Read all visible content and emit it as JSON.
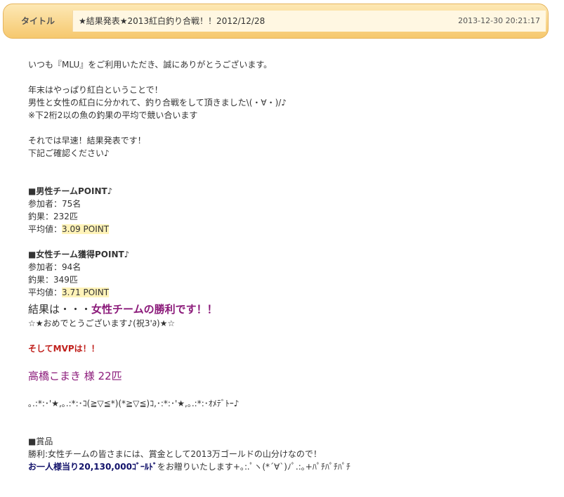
{
  "header": {
    "label": "タイトル",
    "subject": "★結果発表★2013紅白釣り合戦！！2012/12/28",
    "datetime": "2013-12-30 20:21:17"
  },
  "intro": {
    "l1": "いつも『MLU』をご利用いただき、誠にありがとうございます。",
    "l2": "年末はやっぱり紅白ということで！",
    "l3": "男性と女性の紅白に分かれて、釣り合戦をして頂きました\\(・∀・)/♪",
    "l4": "※下2桁2以の魚の釣果の平均で競い合います",
    "l5": "それでは早速！結果発表です！",
    "l6": "下記ご確認ください♪"
  },
  "male": {
    "title": "■男性チームPOINT♪",
    "participants": "参加者：75名",
    "catch": "釣果：232匹",
    "avg_label": "平均値：",
    "avg_value": "3.09 POINT"
  },
  "female": {
    "title": "■女性チーム獲得POINT♪",
    "participants": "参加者：94名",
    "catch": "釣果：349匹",
    "avg_label": "平均値：",
    "avg_value": "3.71 POINT"
  },
  "result": {
    "prefix": "結果は・・・",
    "win": "女性チームの勝利です！！",
    "congrats": "☆★おめでとうございます♪(祝3'∂)★☆"
  },
  "mvp": {
    "heading": "そしてMVPは！！",
    "name": "高橋こまき 様 22匹",
    "deco": "｡.:*:･'★,｡.:*:･ｺ(≧▽≦*)(*≧▽≦)ｺ,･:*:･'★,｡.:*:･ｵﾒﾃﾞﾄｰ♪"
  },
  "prize": {
    "title": "■賞品",
    "desc": "勝利:女性チームの皆さまには、賞金として2013万ゴールドの山分けなので！",
    "bold": "お一人様当り20,130,000ｺﾞｰﾙﾄﾞ",
    "rest": "をお贈りいたします+｡:.ﾟヽ(*´∀`)ﾉﾟ.:｡+ﾊﾟﾁﾊﾟﾁﾊﾟﾁ"
  }
}
